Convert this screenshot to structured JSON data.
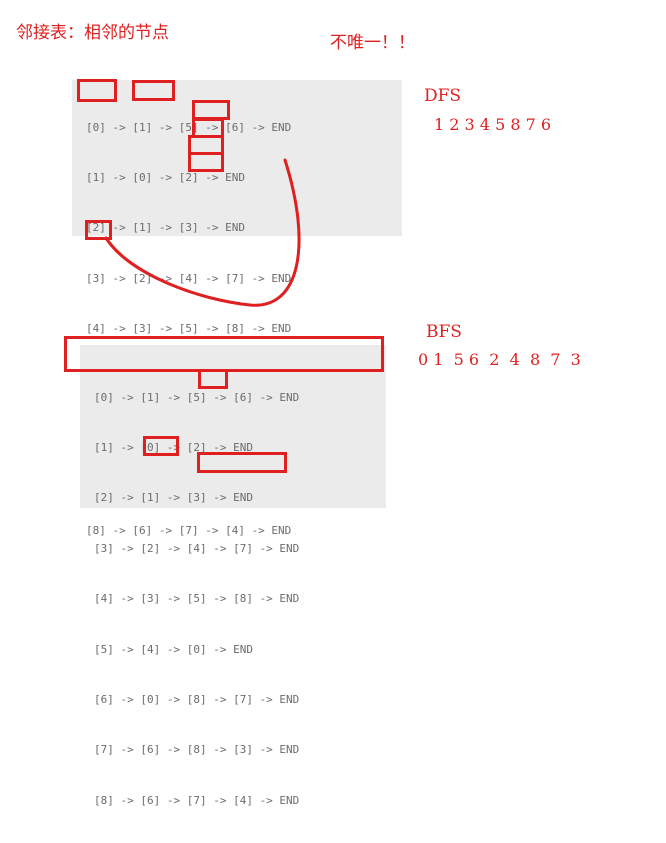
{
  "title": "邻接表：相邻的节点",
  "note": "不唯一！！",
  "dfs": {
    "label": "DFS",
    "order": "1 2 3 4 5 8 7 6"
  },
  "bfs": {
    "label": "BFS",
    "order": "0 1  5 6  2  4  8  7  3"
  },
  "adjacency_rows": [
    "[0] -> [1] -> [5] -> [6] -> END",
    "[1] -> [0] -> [2] -> END",
    "[2] -> [1] -> [3] -> END",
    "[3] -> [2] -> [4] -> [7] -> END",
    "[4] -> [3] -> [5] -> [8] -> END",
    "[5] -> [4] -> [0] -> END",
    "[6] -> [0] -> [8] -> [7] -> END",
    "[7] -> [6] -> [8] -> [3] -> END",
    "[8] -> [6] -> [7] -> [4] -> END"
  ],
  "colors": {
    "annotation": "#e02020",
    "panel": "#ebebeb",
    "code_text": "#6b6b6b"
  }
}
